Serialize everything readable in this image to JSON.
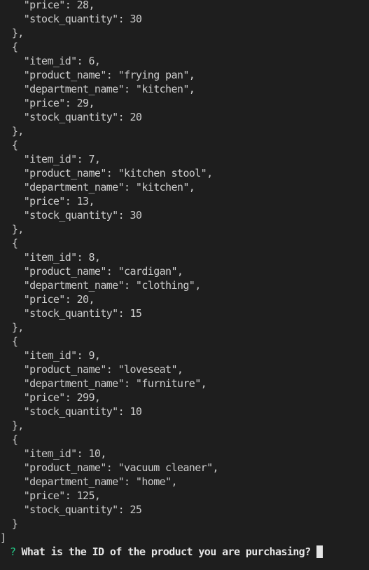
{
  "terminal": {
    "lines": [
      "    \"price\": 28,",
      "    \"stock_quantity\": 30",
      "  },",
      "  {",
      "    \"item_id\": 6,",
      "    \"product_name\": \"frying pan\",",
      "    \"department_name\": \"kitchen\",",
      "    \"price\": 29,",
      "    \"stock_quantity\": 20",
      "  },",
      "  {",
      "    \"item_id\": 7,",
      "    \"product_name\": \"kitchen stool\",",
      "    \"department_name\": \"kitchen\",",
      "    \"price\": 13,",
      "    \"stock_quantity\": 30",
      "  },",
      "  {",
      "    \"item_id\": 8,",
      "    \"product_name\": \"cardigan\",",
      "    \"department_name\": \"clothing\",",
      "    \"price\": 20,",
      "    \"stock_quantity\": 15",
      "  },",
      "  {",
      "    \"item_id\": 9,",
      "    \"product_name\": \"loveseat\",",
      "    \"department_name\": \"furniture\",",
      "    \"price\": 299,",
      "    \"stock_quantity\": 10",
      "  },",
      "  {",
      "    \"item_id\": 10,",
      "    \"product_name\": \"vacuum cleaner\",",
      "    \"department_name\": \"home\",",
      "    \"price\": 125,",
      "    \"stock_quantity\": 25",
      "  }",
      "]"
    ],
    "prompt": {
      "symbol": "?",
      "question": "What is the ID of the product you are purchasing?"
    },
    "colors": {
      "background": "#1e1e1e",
      "text": "#cccccc",
      "prompt_symbol": "#23d18b",
      "question": "#e5e5e5"
    }
  }
}
